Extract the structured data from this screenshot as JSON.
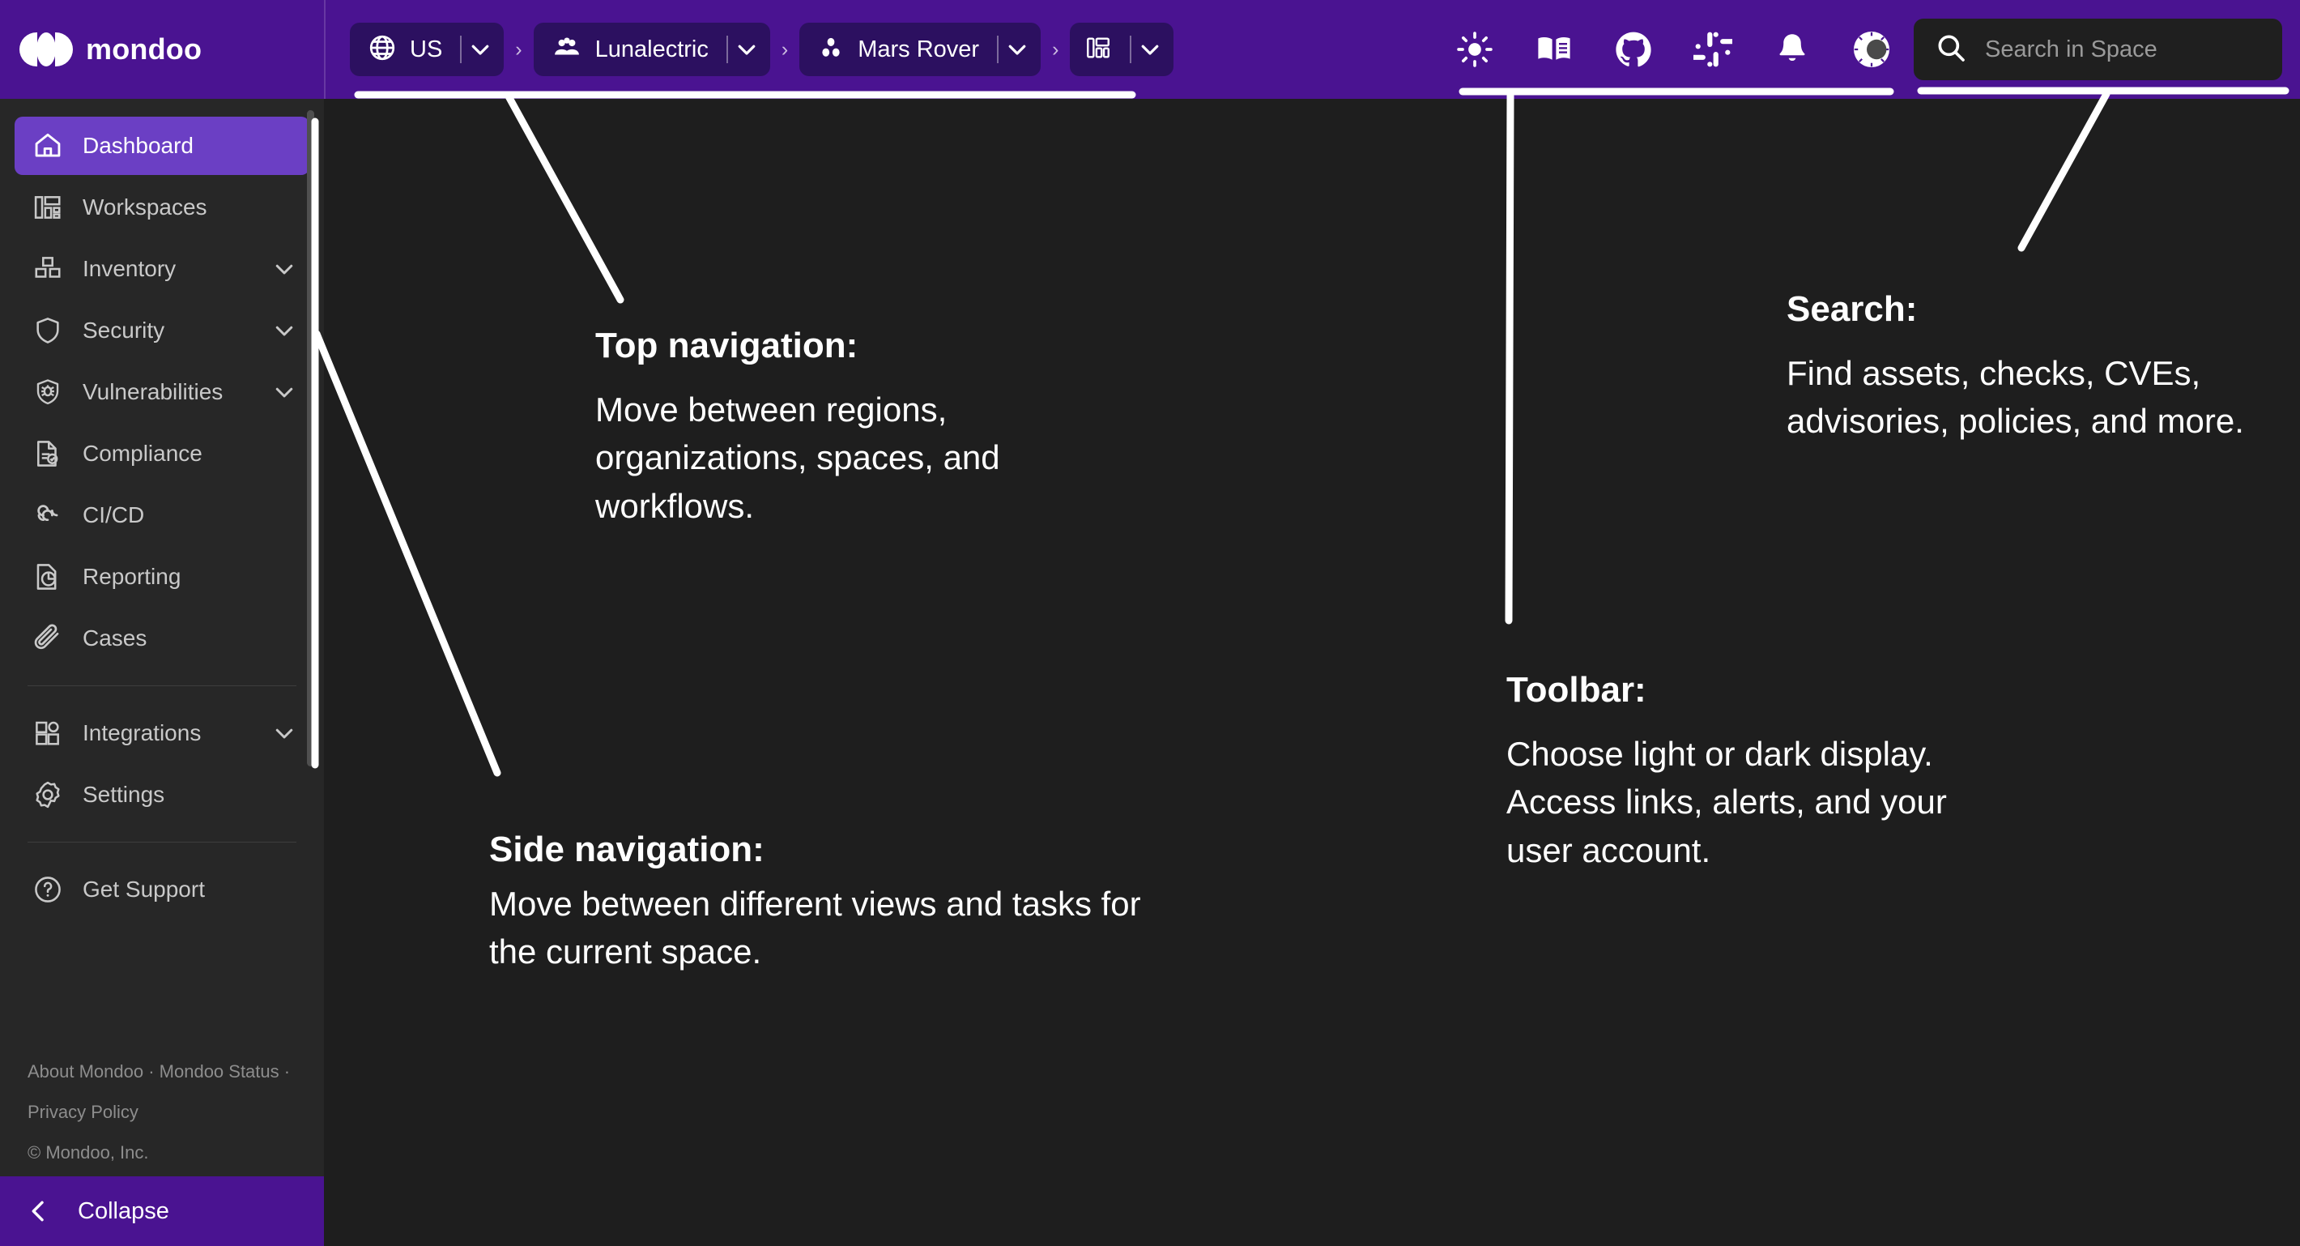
{
  "brand": {
    "name": "mondoo",
    "logo_icon": "mondoo-logo-icon"
  },
  "breadcrumb": {
    "items": [
      {
        "icon": "globe-icon",
        "label": "US",
        "caret_icon": "chevron-down-icon"
      },
      {
        "icon": "organization-people-icon",
        "label": "Lunalectric",
        "caret_icon": "chevron-down-icon"
      },
      {
        "icon": "space-dots-icon",
        "label": "Mars Rover",
        "caret_icon": "chevron-down-icon"
      },
      {
        "icon": "dashboard-grid-icon",
        "label": "",
        "caret_icon": "chevron-down-icon"
      }
    ],
    "separator": "›"
  },
  "toolbar": {
    "items": [
      {
        "icon": "sun-icon",
        "name": "theme-light-toggle"
      },
      {
        "icon": "book-icon",
        "name": "documentation-link"
      },
      {
        "icon": "github-icon",
        "name": "github-link"
      },
      {
        "icon": "slack-icon",
        "name": "slack-link"
      },
      {
        "icon": "bell-icon",
        "name": "notifications-button"
      },
      {
        "icon": "user-avatar-icon",
        "name": "user-account-button"
      }
    ]
  },
  "search": {
    "placeholder": "Search in Space",
    "value": "",
    "icon": "search-icon"
  },
  "sidebar": {
    "items": [
      {
        "label": "Dashboard",
        "icon": "home-icon",
        "active": true,
        "expandable": false
      },
      {
        "label": "Workspaces",
        "icon": "workspaces-grid-icon",
        "active": false,
        "expandable": false
      },
      {
        "label": "Inventory",
        "icon": "inventory-boxes-icon",
        "active": false,
        "expandable": true
      },
      {
        "label": "Security",
        "icon": "shield-icon",
        "active": false,
        "expandable": true
      },
      {
        "label": "Vulnerabilities",
        "icon": "shield-bug-icon",
        "active": false,
        "expandable": true
      },
      {
        "label": "Compliance",
        "icon": "document-check-icon",
        "active": false,
        "expandable": false
      },
      {
        "label": "CI/CD",
        "icon": "infinity-icon",
        "active": false,
        "expandable": false
      },
      {
        "label": "Reporting",
        "icon": "report-chart-icon",
        "active": false,
        "expandable": false
      },
      {
        "label": "Cases",
        "icon": "paperclip-icon",
        "active": false,
        "expandable": false
      }
    ],
    "items2": [
      {
        "label": "Integrations",
        "icon": "integrations-blocks-icon",
        "active": false,
        "expandable": true
      },
      {
        "label": "Settings",
        "icon": "gear-icon",
        "active": false,
        "expandable": false
      }
    ],
    "items3": [
      {
        "label": "Get Support",
        "icon": "question-circle-icon",
        "active": false,
        "expandable": false
      }
    ],
    "footer": {
      "line1": "About Mondoo · Mondoo Status ·",
      "line2": "Privacy Policy",
      "line3": "© Mondoo, Inc."
    },
    "collapse": {
      "label": "Collapse",
      "icon": "chevron-left-icon"
    }
  },
  "callouts": [
    {
      "key": "top-navigation",
      "title": "Top navigation:",
      "body": "Move between regions, organizations, spaces, and workflows."
    },
    {
      "key": "search",
      "title": "Search:",
      "body": "Find assets, checks, CVEs, advisories, policies, and more."
    },
    {
      "key": "toolbar",
      "title": "Toolbar:",
      "body": "Choose light or dark display. Access links, alerts, and your user account."
    },
    {
      "key": "side-navigation",
      "title": "Side navigation:",
      "body": "Move between different views and tasks for the current space."
    }
  ],
  "colors": {
    "header_purple": "#4a1391",
    "pill_purple": "#2c1060",
    "active_purple": "#6b3fc4",
    "sidebar_bg": "#272727",
    "canvas_bg": "#1e1e1e",
    "callout_white": "#ffffff"
  }
}
